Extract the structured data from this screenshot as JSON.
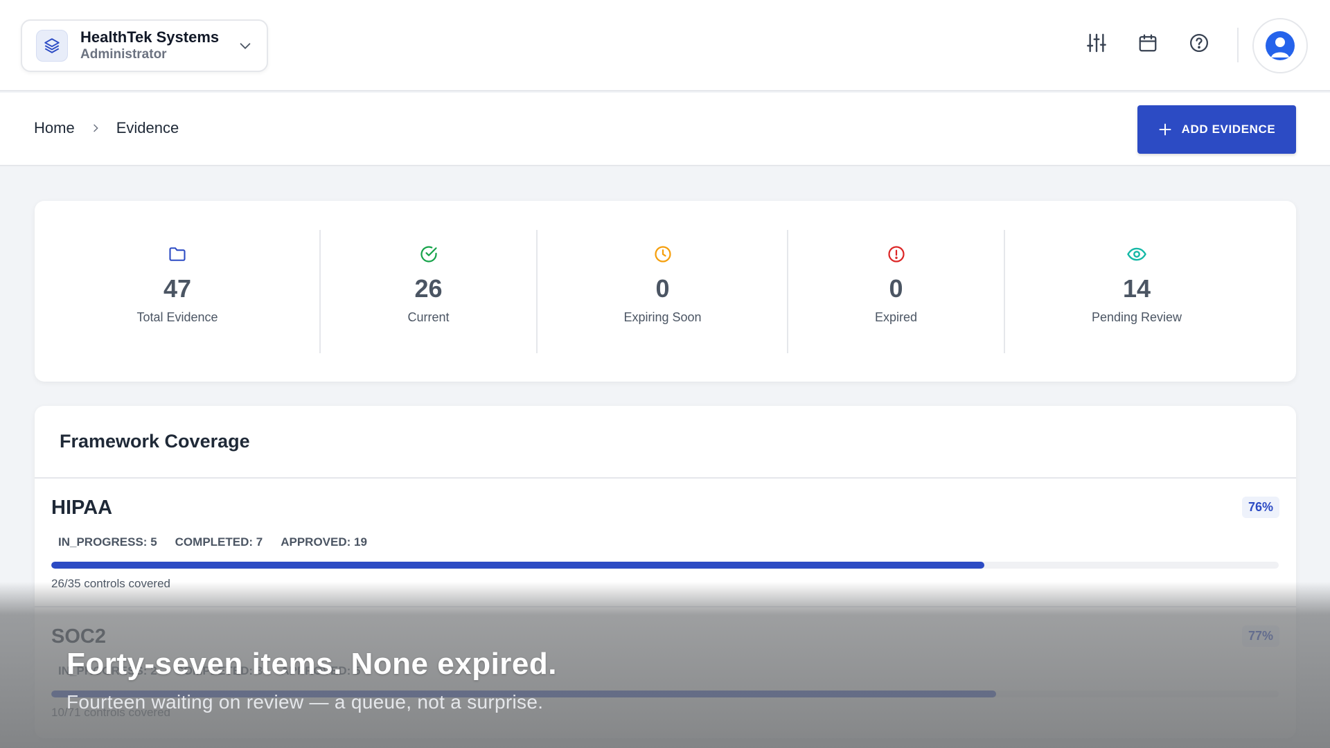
{
  "org": {
    "name": "HealthTek Systems",
    "role": "Administrator"
  },
  "breadcrumb": {
    "home": "Home",
    "current": "Evidence"
  },
  "actions": {
    "add_evidence": "ADD EVIDENCE"
  },
  "stats": [
    {
      "value": "47",
      "label": "Total Evidence",
      "icon": "folder-icon",
      "color": "#2c4bc4"
    },
    {
      "value": "26",
      "label": "Current",
      "icon": "check-circle-icon",
      "color": "#16a34a"
    },
    {
      "value": "0",
      "label": "Expiring Soon",
      "icon": "clock-icon",
      "color": "#f59e0b"
    },
    {
      "value": "0",
      "label": "Expired",
      "icon": "alert-circle-icon",
      "color": "#dc2626"
    },
    {
      "value": "14",
      "label": "Pending Review",
      "icon": "eye-icon",
      "color": "#14b8a6"
    }
  ],
  "coverage": {
    "title": "Framework Coverage",
    "frameworks": [
      {
        "name": "HIPAA",
        "percent_label": "76%",
        "progress": 0.76,
        "statuses": [
          "IN_PROGRESS: 5",
          "COMPLETED: 7",
          "APPROVED: 19"
        ],
        "controls": "26/35 controls covered"
      },
      {
        "name": "SOC2",
        "percent_label": "77%",
        "progress": 0.77,
        "statuses": [
          "IN_PROGRESS: 2",
          "COMPLETED: 3",
          "APPROVED: 5"
        ],
        "controls": "10/71 controls covered"
      }
    ]
  },
  "caption": {
    "main": "Forty-seven items. None expired.",
    "sub": "Fourteen waiting on review — a queue, not a surprise."
  },
  "colors": {
    "accent": "#2c4bc4",
    "background": "#f2f4f7"
  }
}
